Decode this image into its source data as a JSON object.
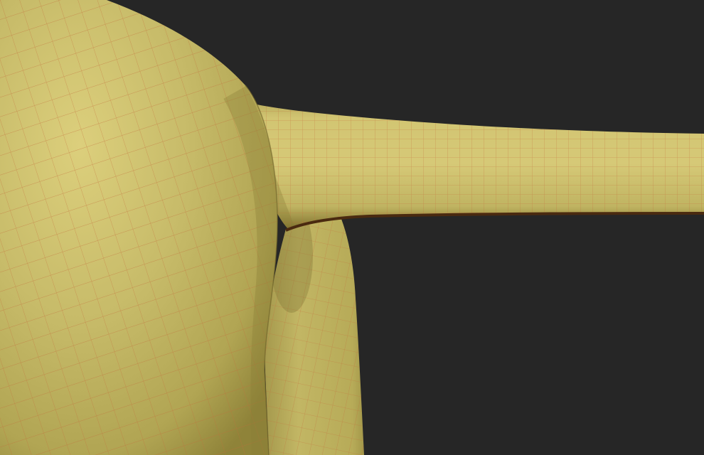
{
  "scene": {
    "background_color": "#262626",
    "mesh_base_color": "#c4b865",
    "mesh_highlight_color": "#dccf7c",
    "mesh_shadow_color": "#7f7234",
    "wireframe_color": "#c26b3a",
    "crease_color": "#4a2a10"
  }
}
